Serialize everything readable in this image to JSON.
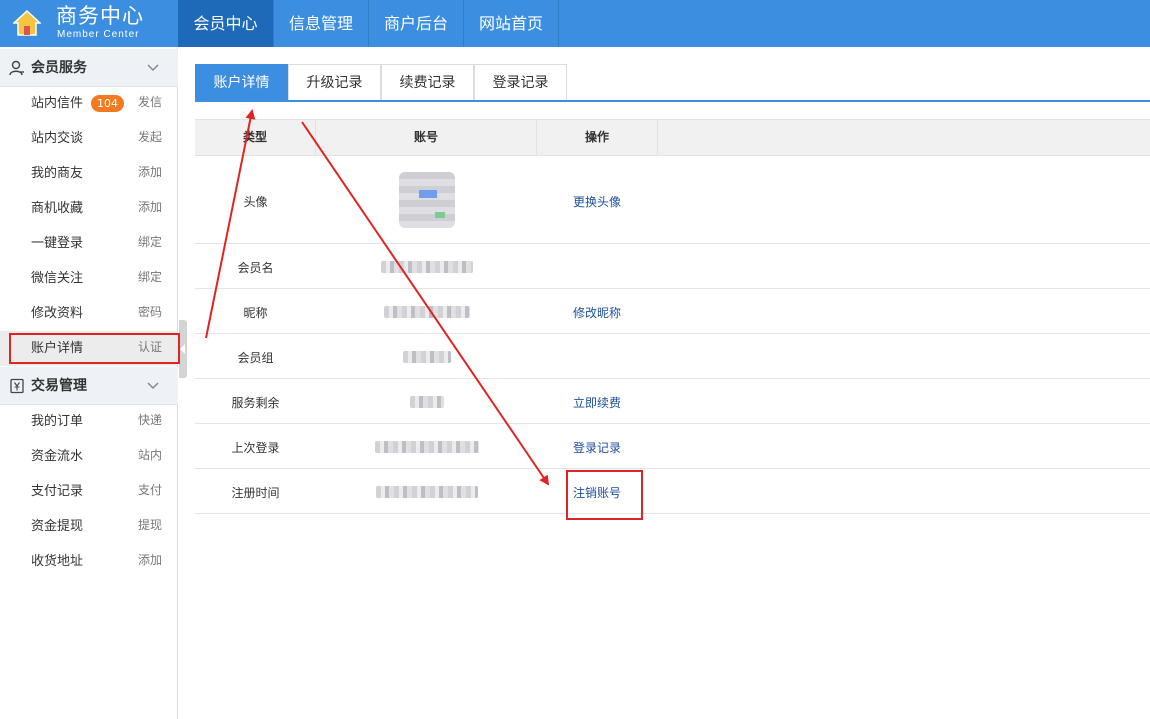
{
  "header": {
    "app_title": "商务中心",
    "app_subtitle": "Member Center",
    "nav": [
      {
        "label": "会员中心",
        "active": true
      },
      {
        "label": "信息管理",
        "active": false
      },
      {
        "label": "商户后台",
        "active": false
      },
      {
        "label": "网站首页",
        "active": false
      }
    ]
  },
  "sidebar": {
    "sections": [
      {
        "title": "会员服务",
        "icon": "user-icon",
        "items": [
          {
            "label": "站内信件",
            "badge": "104",
            "action": "发信"
          },
          {
            "label": "站内交谈",
            "action": "发起"
          },
          {
            "label": "我的商友",
            "action": "添加"
          },
          {
            "label": "商机收藏",
            "action": "添加"
          },
          {
            "label": "一键登录",
            "action": "绑定"
          },
          {
            "label": "微信关注",
            "action": "绑定"
          },
          {
            "label": "修改资料",
            "action": "密码"
          },
          {
            "label": "账户详情",
            "action": "认证",
            "current": true
          }
        ]
      },
      {
        "title": "交易管理",
        "icon": "yen-wallet-icon",
        "items": [
          {
            "label": "我的订单",
            "action": "快递"
          },
          {
            "label": "资金流水",
            "action": "站内"
          },
          {
            "label": "支付记录",
            "action": "支付"
          },
          {
            "label": "资金提现",
            "action": "提现"
          },
          {
            "label": "收货地址",
            "action": "添加"
          }
        ]
      }
    ]
  },
  "tabs": [
    {
      "label": "账户详情",
      "active": true
    },
    {
      "label": "升级记录",
      "active": false
    },
    {
      "label": "续费记录",
      "active": false
    },
    {
      "label": "登录记录",
      "active": false
    }
  ],
  "table": {
    "headers": [
      "类型",
      "账号",
      "操作"
    ],
    "rows": [
      {
        "type": "头像",
        "value_redacted": true,
        "action": "更换头像"
      },
      {
        "type": "会员名",
        "value_redacted": true,
        "action": ""
      },
      {
        "type": "昵称",
        "value_redacted": true,
        "action": "修改昵称"
      },
      {
        "type": "会员组",
        "value_redacted": true,
        "action": ""
      },
      {
        "type": "服务剩余",
        "value_redacted": true,
        "action": "立即续费"
      },
      {
        "type": "上次登录",
        "value_redacted": true,
        "action": "登录记录"
      },
      {
        "type": "注册时间",
        "value_redacted": true,
        "action": "注销账号"
      }
    ]
  },
  "colors": {
    "header_bg": "#3b8ee0",
    "nav_active_bg": "#1f6ab8",
    "badge": "#f47a20",
    "link": "#1c4f9c",
    "annotation_red": "#e02424"
  }
}
